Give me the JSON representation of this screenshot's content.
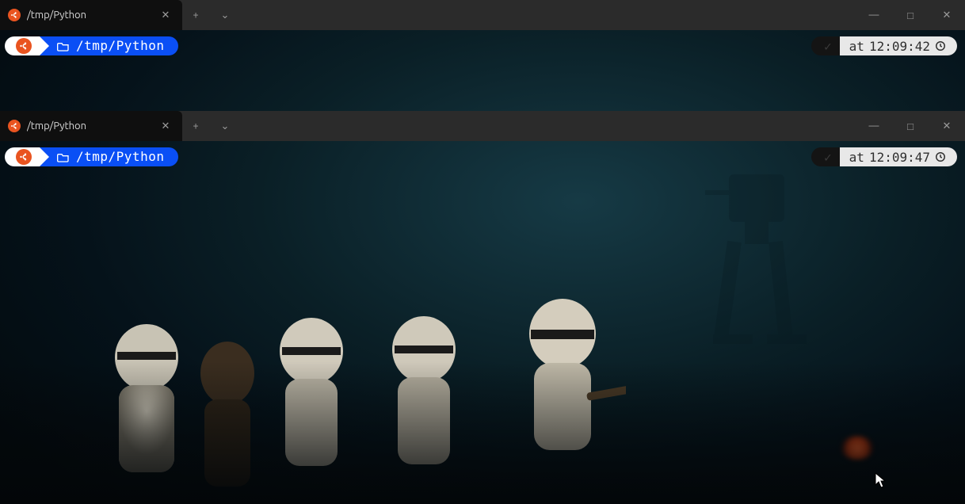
{
  "windows": [
    {
      "tab": {
        "title": "/tmp/Python",
        "distro": "ubuntu"
      },
      "prompt": {
        "path": "/tmp/Python",
        "folder_icon": "folder-open-icon"
      },
      "status": {
        "check": "✓",
        "time_prefix": "at",
        "time": "12:09:42",
        "clock_icon": "clock-icon"
      }
    },
    {
      "tab": {
        "title": "/tmp/Python",
        "distro": "ubuntu"
      },
      "prompt": {
        "path": "/tmp/Python",
        "folder_icon": "folder-open-icon"
      },
      "status": {
        "check": "✓",
        "time_prefix": "at",
        "time": "12:09:47",
        "clock_icon": "clock-icon"
      }
    }
  ],
  "titlebar_icons": {
    "newtab": "+",
    "dropdown": "⌄",
    "minimize": "—",
    "maximize": "□",
    "close": "✕",
    "tab_close": "✕"
  },
  "colors": {
    "prompt_blue": "#0a4ff5",
    "prompt_white": "#ffffff",
    "ubuntu_orange": "#e95420",
    "status_time_bg": "#e8e8e8",
    "status_time_fg": "#2f2f2f"
  }
}
